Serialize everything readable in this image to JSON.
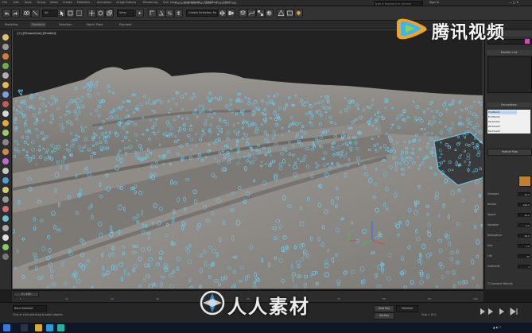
{
  "app": {
    "window_title": "Autodesk 3ds Max 2017 - Particle Flow",
    "workspace_label": "Workspace: Default",
    "search_placeholder": "Type a keyword or phrase",
    "sign_in": "Sign In"
  },
  "menu": [
    "File",
    "Edit",
    "Tools",
    "Group",
    "Views",
    "Create",
    "Modifiers",
    "Animation",
    "Graph Editors",
    "Rendering",
    "Civil View",
    "Customize",
    "Scripting",
    "Help"
  ],
  "toolbar": {
    "undo_icon": "undo-icon",
    "redo_icon": "redo-icon",
    "selection_filter": "All",
    "view_dropdown": "View",
    "named_selection": "Create Selection Se"
  },
  "ribbon_tabs": [
    "Modeling",
    "Freeform",
    "Selection",
    "Object Paint",
    "Populate"
  ],
  "viewport": {
    "label": "[+] [Perspective] [Shaded]",
    "gizmo_axes": [
      "X",
      "Y",
      "Z"
    ]
  },
  "command_panel": {
    "header": "Modifier List",
    "section_parameters": "Parameters",
    "list_items": [
      "Emitter01",
      "Emitter02",
      "Particle01",
      "Particle02",
      "Particle03"
    ],
    "rows": [
      {
        "label": "Viewport",
        "value": "10.0"
      },
      {
        "label": "Render",
        "value": "100.0"
      },
      {
        "label": "Speed",
        "value": "10.0"
      },
      {
        "label": "Variation",
        "value": "0.0"
      },
      {
        "label": "Divergence",
        "value": "10.0"
      },
      {
        "label": "Size",
        "value": "1.0"
      },
      {
        "label": "Life",
        "value": "30"
      },
      {
        "label": "Subframe",
        "value": "1"
      }
    ],
    "checkbox_label": "Constant Velocity",
    "button_label": "Particle Flow"
  },
  "timeline": {
    "frame": "0 / 100",
    "ticks": [
      "0",
      "10",
      "20",
      "30",
      "40",
      "50",
      "60",
      "70",
      "80",
      "90",
      "100"
    ]
  },
  "status": {
    "message": "None Selected",
    "prompt": "Click or click-and-drag to select objects",
    "autokey": "Auto Key",
    "set_key": "Set Key",
    "selected": "Selected",
    "grid": "Grid = 10.0"
  },
  "watermarks": {
    "tencent": "腾讯视频",
    "renren": "人人素材"
  },
  "colors": {
    "particles": "#5fd3ff",
    "cloth": "#8a8783",
    "cloth_shadow": "#5e5c59",
    "background": "#1e1e1e",
    "accent": "#29a8ff"
  }
}
